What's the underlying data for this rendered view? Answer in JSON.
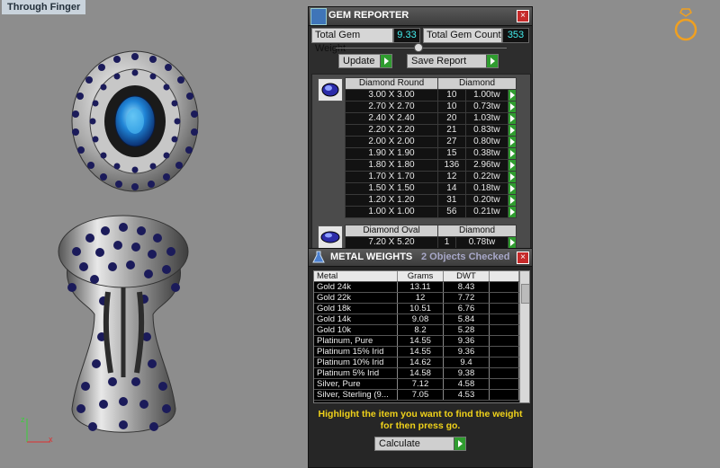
{
  "viewport": {
    "label": "Through Finger",
    "axis_y": "z",
    "axis_x": "x"
  },
  "gem_reporter": {
    "title": "GEM REPORTER",
    "total_weight_label": "Total Gem Weight",
    "total_weight_value": "9.33",
    "total_count_label": "Total Gem Count",
    "total_count_value": "353",
    "update_label": "Update",
    "save_report_label": "Save Report",
    "round": {
      "header_shape": "Diamond Round",
      "header_type": "Diamond",
      "rows": [
        {
          "size": "3.00 X 3.00",
          "count": "10",
          "weight": "1.00tw"
        },
        {
          "size": "2.70 X 2.70",
          "count": "10",
          "weight": "0.73tw"
        },
        {
          "size": "2.40 X 2.40",
          "count": "20",
          "weight": "1.03tw"
        },
        {
          "size": "2.20 X 2.20",
          "count": "21",
          "weight": "0.83tw"
        },
        {
          "size": "2.00 X 2.00",
          "count": "27",
          "weight": "0.80tw"
        },
        {
          "size": "1.90 X 1.90",
          "count": "15",
          "weight": "0.38tw"
        },
        {
          "size": "1.80 X 1.80",
          "count": "136",
          "weight": "2.96tw"
        },
        {
          "size": "1.70 X 1.70",
          "count": "12",
          "weight": "0.22tw"
        },
        {
          "size": "1.50 X 1.50",
          "count": "14",
          "weight": "0.18tw"
        },
        {
          "size": "1.20 X 1.20",
          "count": "31",
          "weight": "0.20tw"
        },
        {
          "size": "1.00 X 1.00",
          "count": "56",
          "weight": "0.21tw"
        }
      ]
    },
    "oval": {
      "header_shape": "Diamond Oval",
      "header_type": "Diamond",
      "rows": [
        {
          "size": "7.20 X 5.20",
          "count": "1",
          "weight": "0.78tw"
        }
      ]
    }
  },
  "metal_weights": {
    "title": "METAL WEIGHTS",
    "status": "2 Objects Checked",
    "col_metal": "Metal",
    "col_grams": "Grams",
    "col_dwt": "DWT",
    "rows": [
      {
        "metal": "Gold 24k",
        "grams": "13.11",
        "dwt": "8.43"
      },
      {
        "metal": "Gold 22k",
        "grams": "12",
        "dwt": "7.72"
      },
      {
        "metal": "Gold 18k",
        "grams": "10.51",
        "dwt": "6.76"
      },
      {
        "metal": "Gold 14k",
        "grams": "9.08",
        "dwt": "5.84"
      },
      {
        "metal": "Gold 10k",
        "grams": "8.2",
        "dwt": "5.28"
      },
      {
        "metal": "Platinum, Pure",
        "grams": "14.55",
        "dwt": "9.36"
      },
      {
        "metal": "Platinum 15% Irid",
        "grams": "14.55",
        "dwt": "9.36"
      },
      {
        "metal": "Platinum 10% Irid",
        "grams": "14.62",
        "dwt": "9.4"
      },
      {
        "metal": "Platinum 5% Irid",
        "grams": "14.58",
        "dwt": "9.38"
      },
      {
        "metal": "Silver, Pure",
        "grams": "7.12",
        "dwt": "4.58"
      },
      {
        "metal": "Silver, Sterling (9...",
        "grams": "7.05",
        "dwt": "4.53"
      }
    ],
    "hint": "Highlight the item you want to find the weight for then press go.",
    "calculate_label": "Calculate"
  },
  "colors": {
    "accent_green": "#2f9c2f",
    "hint_yellow": "#f0d21a",
    "value_cyan": "#44eeee",
    "close_red": "#c62a2a"
  }
}
